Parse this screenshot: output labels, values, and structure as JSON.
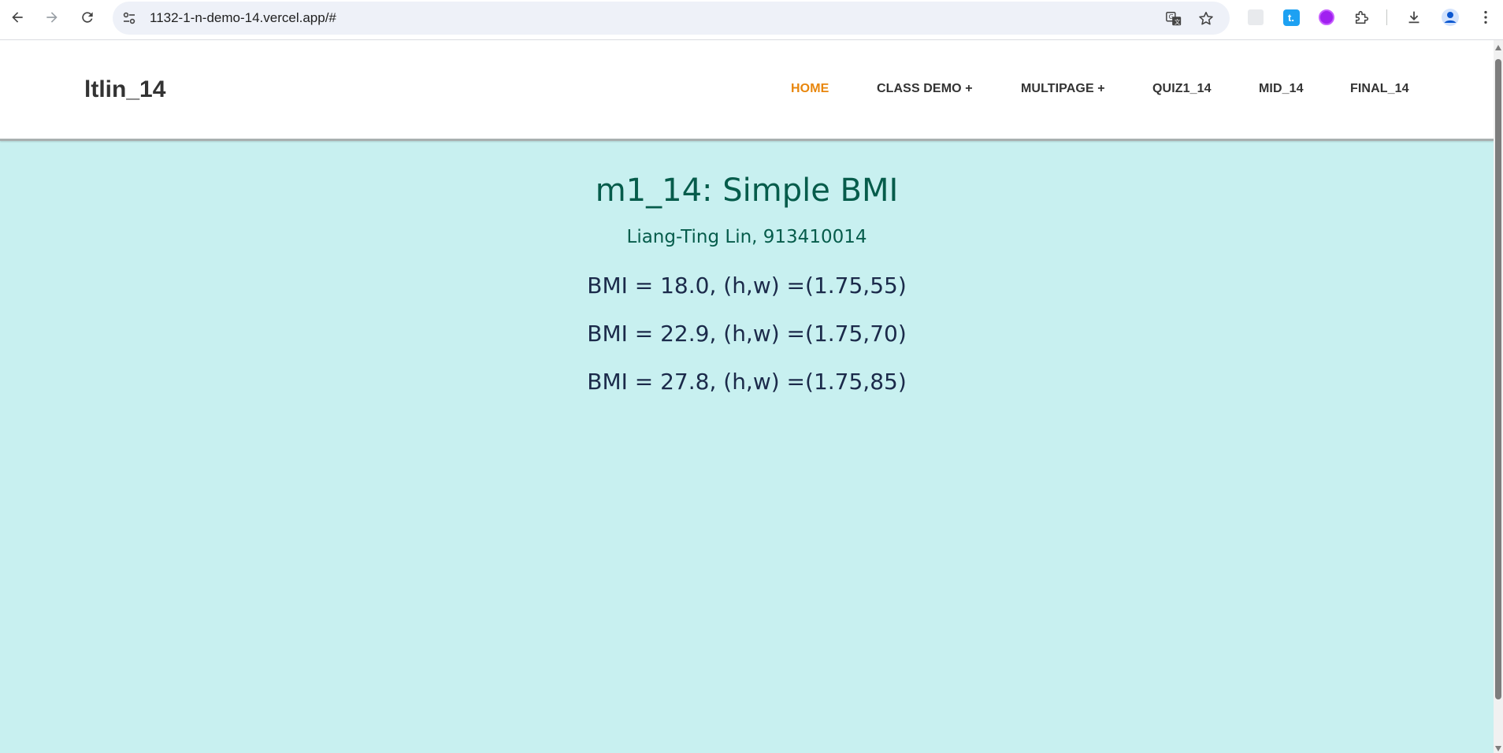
{
  "browser": {
    "url": "1132-1-n-demo-14.vercel.app/#",
    "icons": [
      "back-icon",
      "forward-icon",
      "reload-icon",
      "site-settings-icon",
      "translate-icon",
      "bookmark-star-icon",
      "extension-blank-icon",
      "extension-t-icon",
      "extension-purple-icon",
      "extensions-puzzle-icon",
      "download-icon",
      "profile-icon",
      "menu-dots-icon"
    ],
    "ext_t_label": "t."
  },
  "site": {
    "logo": "ltlin_14",
    "menu": [
      {
        "label": "HOME",
        "active": true
      },
      {
        "label": "CLASS DEMO +",
        "active": false
      },
      {
        "label": "MULTIPAGE +",
        "active": false
      },
      {
        "label": "QUIZ1_14",
        "active": false
      },
      {
        "label": "MID_14",
        "active": false
      },
      {
        "label": "FINAL_14",
        "active": false
      }
    ],
    "accent_color": "#e8860c"
  },
  "main": {
    "title": "m1_14: Simple BMI",
    "subtitle": "Liang-Ting Lin, 913410014",
    "bmi_rows": [
      "BMI = 18.0, (h,w) =(1.75,55)",
      "BMI = 22.9, (h,w) =(1.75,70)",
      "BMI = 27.8, (h,w) =(1.75,85)"
    ],
    "background_color": "#c8f0f0"
  }
}
